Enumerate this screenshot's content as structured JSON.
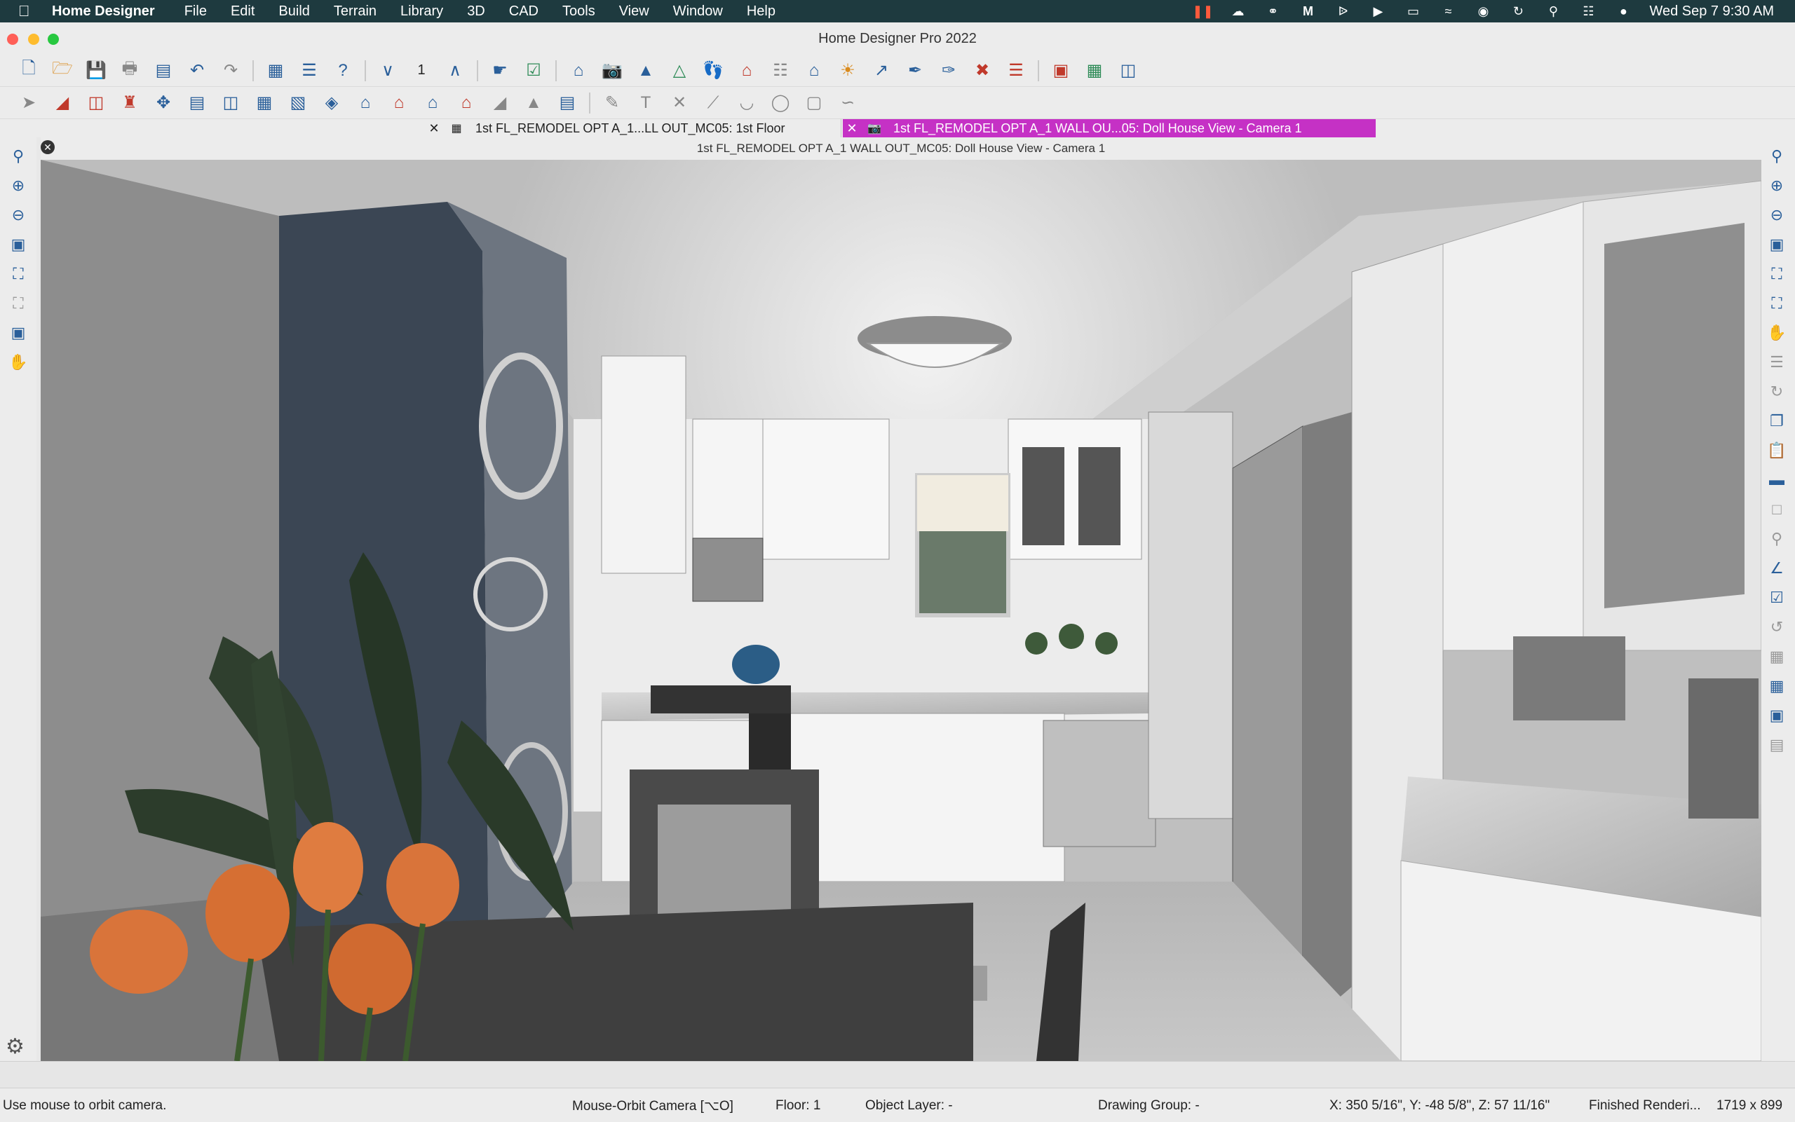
{
  "menubar": {
    "app_name": "Home Designer",
    "items": [
      "File",
      "Edit",
      "Build",
      "Terrain",
      "Library",
      "3D",
      "CAD",
      "Tools",
      "View",
      "Window",
      "Help"
    ],
    "clock": "Wed Sep 7  9:30 AM"
  },
  "window": {
    "title": "Home Designer Pro 2022"
  },
  "tabs": [
    {
      "label": "1st FL_REMODEL OPT A_1...LL OUT_MC05: 1st Floor",
      "active": false
    },
    {
      "label": "1st FL_REMODEL OPT A_1 WALL OU...05: Doll House View - Camera 1",
      "active": true
    }
  ],
  "view": {
    "caption": "1st FL_REMODEL OPT A_1 WALL OUT_MC05: Doll House View - Camera 1"
  },
  "toolbar": {
    "floor_value": "1"
  },
  "status": {
    "hint": "Use mouse to orbit camera.",
    "mode": "Mouse-Orbit Camera [⌥O]",
    "floor": "Floor: 1",
    "object_layer": "Object Layer: -",
    "drawing_group": "Drawing Group: -",
    "coords": "X: 350 5/16\", Y: -48 5/8\", Z: 57 11/16\"",
    "render": "Finished Renderi...",
    "size": "1719 x 899"
  },
  "colors": {
    "menubar_bg": "#1e3a3f",
    "active_tab": "#c531c5",
    "traffic_close": "#ff5f57",
    "traffic_min": "#febc2e",
    "traffic_max": "#28c840",
    "tulip_orange": "#d9743a",
    "accent_wall": "#3b4654"
  }
}
